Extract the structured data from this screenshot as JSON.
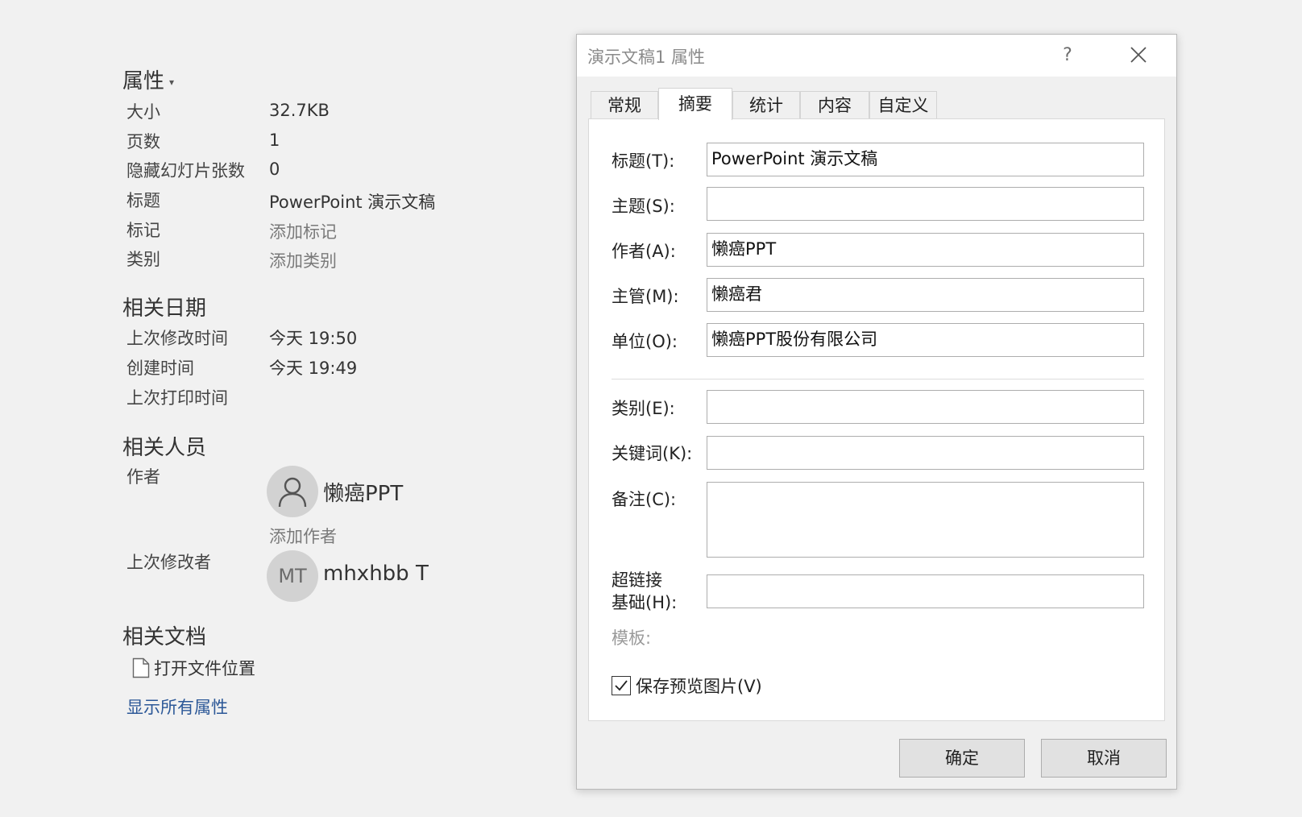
{
  "properties": {
    "heading": "属性",
    "rows": [
      {
        "label": "大小",
        "value": "32.7KB",
        "placeholder": false
      },
      {
        "label": "页数",
        "value": "1",
        "placeholder": false
      },
      {
        "label": "隐藏幻灯片张数",
        "value": "0",
        "placeholder": false
      },
      {
        "label": "标题",
        "value": "PowerPoint 演示文稿",
        "placeholder": false
      },
      {
        "label": "标记",
        "value": "添加标记",
        "placeholder": true
      },
      {
        "label": "类别",
        "value": "添加类别",
        "placeholder": true
      }
    ]
  },
  "dates": {
    "heading": "相关日期",
    "rows": [
      {
        "label": "上次修改时间",
        "value": "今天 19:50"
      },
      {
        "label": "创建时间",
        "value": "今天 19:49"
      },
      {
        "label": "上次打印时间",
        "value": ""
      }
    ]
  },
  "people": {
    "heading": "相关人员",
    "author_label": "作者",
    "author_name": "懒癌PPT",
    "add_author": "添加作者",
    "modifier_label": "上次修改者",
    "modifier_initials": "MT",
    "modifier_name": "mhxhbb T"
  },
  "documents": {
    "heading": "相关文档",
    "open_location": "打开文件位置",
    "show_all": "显示所有属性"
  },
  "dialog": {
    "title": "演示文稿1 属性",
    "help": "?",
    "tabs": [
      "常规",
      "摘要",
      "统计",
      "内容",
      "自定义"
    ],
    "active_tab": "摘要",
    "fields": {
      "title_label": "标题(T):",
      "title_value": "PowerPoint 演示文稿",
      "subject_label": "主题(S):",
      "subject_value": "",
      "author_label": "作者(A):",
      "author_value": "懒癌PPT",
      "manager_label": "主管(M):",
      "manager_value": "懒癌君",
      "company_label": "单位(O):",
      "company_value": "懒癌PPT股份有限公司",
      "category_label": "类别(E):",
      "category_value": "",
      "keywords_label": "关键词(K):",
      "keywords_value": "",
      "comments_label": "备注(C):",
      "comments_value": "",
      "hyperlink_label_1": "超链接",
      "hyperlink_label_2": "基础(H):",
      "hyperlink_value": "",
      "template_label": "模板:"
    },
    "save_preview_label": "保存预览图片(V)",
    "save_preview_checked": true,
    "ok_label": "确定",
    "cancel_label": "取消"
  }
}
